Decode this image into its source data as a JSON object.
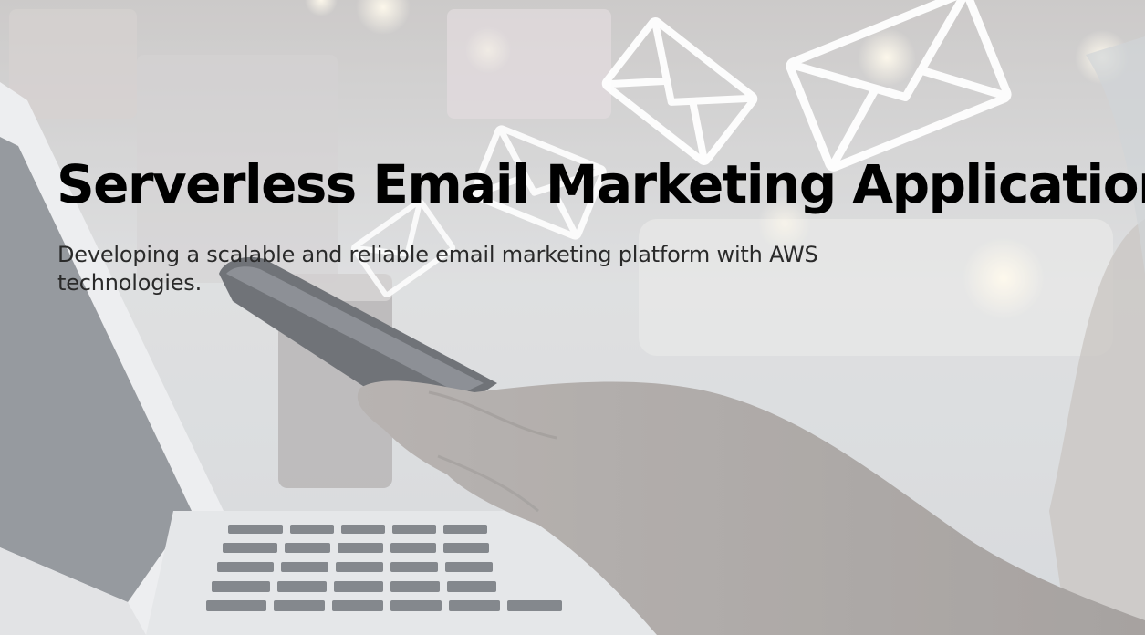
{
  "slide": {
    "title": "Serverless Email Marketing Application",
    "subtitle": "Developing a scalable and reliable email marketing platform with AWS technologies.",
    "background_image": {
      "description_icons": [
        "envelope-icon",
        "envelope-icon",
        "envelope-icon",
        "envelope-icon"
      ],
      "subjects": [
        "laptop",
        "smartphone",
        "hand"
      ]
    }
  }
}
